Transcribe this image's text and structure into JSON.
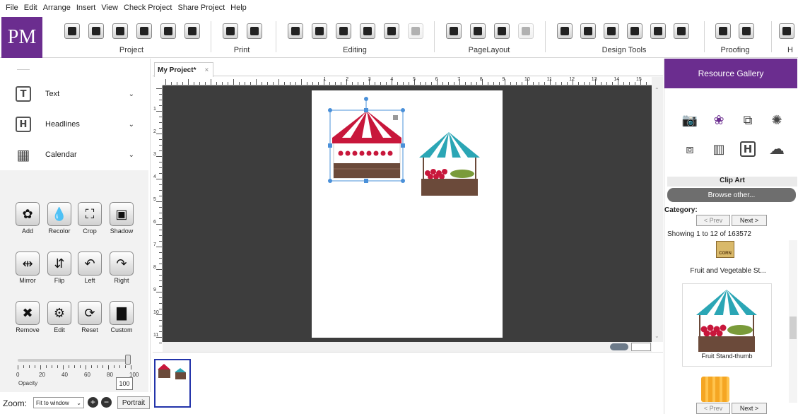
{
  "menu": [
    "File",
    "Edit",
    "Arrange",
    "Insert",
    "View",
    "Check Project",
    "Share Project",
    "Help"
  ],
  "logo": "PM",
  "ribbon": {
    "groups": [
      {
        "label": "Project",
        "icons": [
          "new-icon",
          "open-icon",
          "save-icon",
          "save-as-icon",
          "export-pdf-icon",
          "manage-icon"
        ]
      },
      {
        "label": "Print",
        "icons": [
          "printer-icon",
          "share-icon"
        ]
      },
      {
        "label": "Editing",
        "icons": [
          "cut-icon",
          "copy-icon",
          "paste-icon",
          "add-text-icon",
          "undo-icon",
          "redo-icon"
        ]
      },
      {
        "label": "PageLayout",
        "icons": [
          "page-setup-icon",
          "grid-icon",
          "align-icon",
          "background-icon"
        ]
      },
      {
        "label": "Design Tools",
        "icons": [
          "photo-icon",
          "camera-icon",
          "coin-icon",
          "headline-icon",
          "flower-icon",
          "badge-icon"
        ]
      },
      {
        "label": "Proofing",
        "icons": [
          "eye-proof-icon",
          "spell-check-icon"
        ]
      },
      {
        "label": "H",
        "icons": [
          "lightbulb-icon"
        ]
      }
    ]
  },
  "left_panel": {
    "categories": [
      {
        "label": "Text",
        "icon": "T"
      },
      {
        "label": "Headlines",
        "icon": "H"
      },
      {
        "label": "Calendar",
        "icon": "▦"
      },
      {
        "label": "Clip Art",
        "icon": "❀"
      }
    ],
    "tools": [
      {
        "label": "Add",
        "glyph": "✿"
      },
      {
        "label": "Recolor",
        "glyph": "💧"
      },
      {
        "label": "Crop",
        "glyph": "⛶"
      },
      {
        "label": "Shadow",
        "glyph": "▣"
      },
      {
        "label": "Mirror",
        "glyph": "⇹"
      },
      {
        "label": "Flip",
        "glyph": "⇵"
      },
      {
        "label": "Left",
        "glyph": "↶"
      },
      {
        "label": "Right",
        "glyph": "↷"
      },
      {
        "label": "Remove",
        "glyph": "✖"
      },
      {
        "label": "Edit",
        "glyph": "⚙"
      },
      {
        "label": "Reset",
        "glyph": "⟳"
      },
      {
        "label": "Custom",
        "glyph": "▇"
      }
    ],
    "opacity": {
      "label": "Opacity",
      "value": "100",
      "fraction": 1.0,
      "ticks": [
        "0",
        "20",
        "40",
        "60",
        "80",
        "100"
      ]
    }
  },
  "zoom": {
    "label": "Zoom:",
    "value": "Fit to window",
    "orientation": "Portrait"
  },
  "document": {
    "tab_title": "My Project*",
    "close": "×",
    "ruler_numbers": [
      "1",
      "2",
      "3",
      "4",
      "5",
      "6",
      "7",
      "8",
      "9",
      "10",
      "11",
      "12",
      "13",
      "14",
      "15"
    ],
    "vertical_ruler": [
      "1",
      "2",
      "3",
      "4",
      "5",
      "6",
      "7",
      "8",
      "9",
      "10",
      "11"
    ]
  },
  "gallery": {
    "title": "Resource Gallery",
    "section": "Clip Art",
    "browse": "Browse other...",
    "category_label": "Category:",
    "prev": "< Prev",
    "next": "Next >",
    "showing": "Showing 1 to 12 of 163572",
    "items": [
      "Fruit and Vegetable St...",
      "Fruit Stand-thumb"
    ],
    "corn_sign": "CORN"
  },
  "colors": {
    "brand": "#6b2d8f",
    "canvas": "#3d3d3d",
    "awning_red": "#c8173b",
    "awning_teal": "#2ba6b5",
    "stand_brown": "#6b4a3a"
  }
}
